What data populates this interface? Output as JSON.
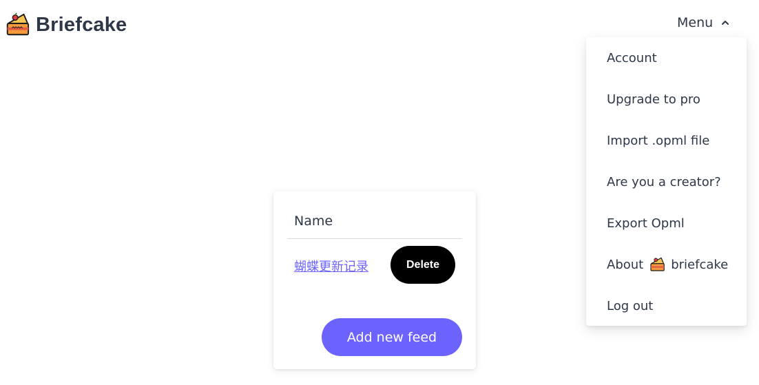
{
  "app": {
    "title": "Briefcake",
    "logo_icon": "cake-slice-icon"
  },
  "menu": {
    "label": "Menu",
    "state_icon": "chevron-up-icon",
    "items": [
      {
        "label": "Account"
      },
      {
        "label": "Upgrade to pro"
      },
      {
        "label": "Import .opml file"
      },
      {
        "label": "Are you a creator?"
      },
      {
        "label": "Export Opml"
      },
      {
        "label_prefix": "About",
        "label_suffix": "briefcake",
        "icon": "cake-slice-icon"
      },
      {
        "label": "Log out"
      }
    ]
  },
  "feeds_card": {
    "column_header": "Name",
    "rows": [
      {
        "name": "蝴蝶更新记录",
        "delete_label": "Delete"
      }
    ],
    "add_label": "Add new feed"
  },
  "colors": {
    "accent": "#6c63ff",
    "text": "#2d3748",
    "delete_bg": "#000000"
  }
}
